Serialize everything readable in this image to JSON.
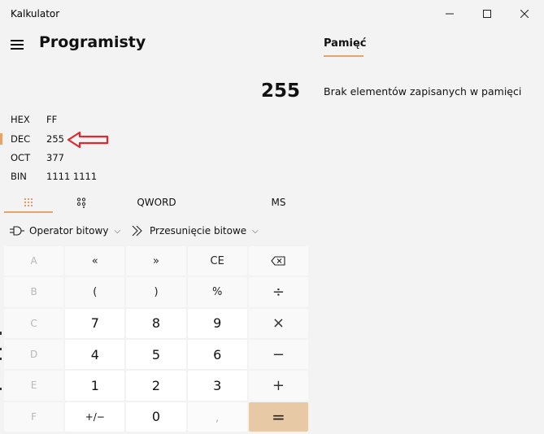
{
  "window": {
    "title": "Kalkulator",
    "minimize_glyph": "—",
    "maximize_glyph": "☐",
    "close_glyph": "✕"
  },
  "header": {
    "mode_title": "Programisty"
  },
  "display": {
    "value": "255"
  },
  "radix": [
    {
      "label": "HEX",
      "value": "FF"
    },
    {
      "label": "DEC",
      "value": "255"
    },
    {
      "label": "OCT",
      "value": "377"
    },
    {
      "label": "BIN",
      "value": "1111 1111"
    }
  ],
  "tabs": {
    "word_size": "QWORD",
    "memory_store": "MS"
  },
  "toolbar": {
    "bitwise": "Operator bitowy",
    "bitshift": "Przesunięcie bitowe"
  },
  "keypad": [
    [
      "A",
      "«",
      "»",
      "CE",
      "⌫"
    ],
    [
      "B",
      "(",
      ")",
      "%",
      "÷"
    ],
    [
      "C",
      "7",
      "8",
      "9",
      "×"
    ],
    [
      "D",
      "4",
      "5",
      "6",
      "−"
    ],
    [
      "E",
      "1",
      "2",
      "3",
      "+"
    ],
    [
      "F",
      "+/−",
      "0",
      ",",
      "="
    ]
  ],
  "memory": {
    "title": "Pamięć",
    "empty_message": "Brak elementów zapisanych w pamięci"
  },
  "colors": {
    "accent": "#e6a36b",
    "equals_bg": "#e8c9a6",
    "annotation_arrow": "#e0282e"
  }
}
